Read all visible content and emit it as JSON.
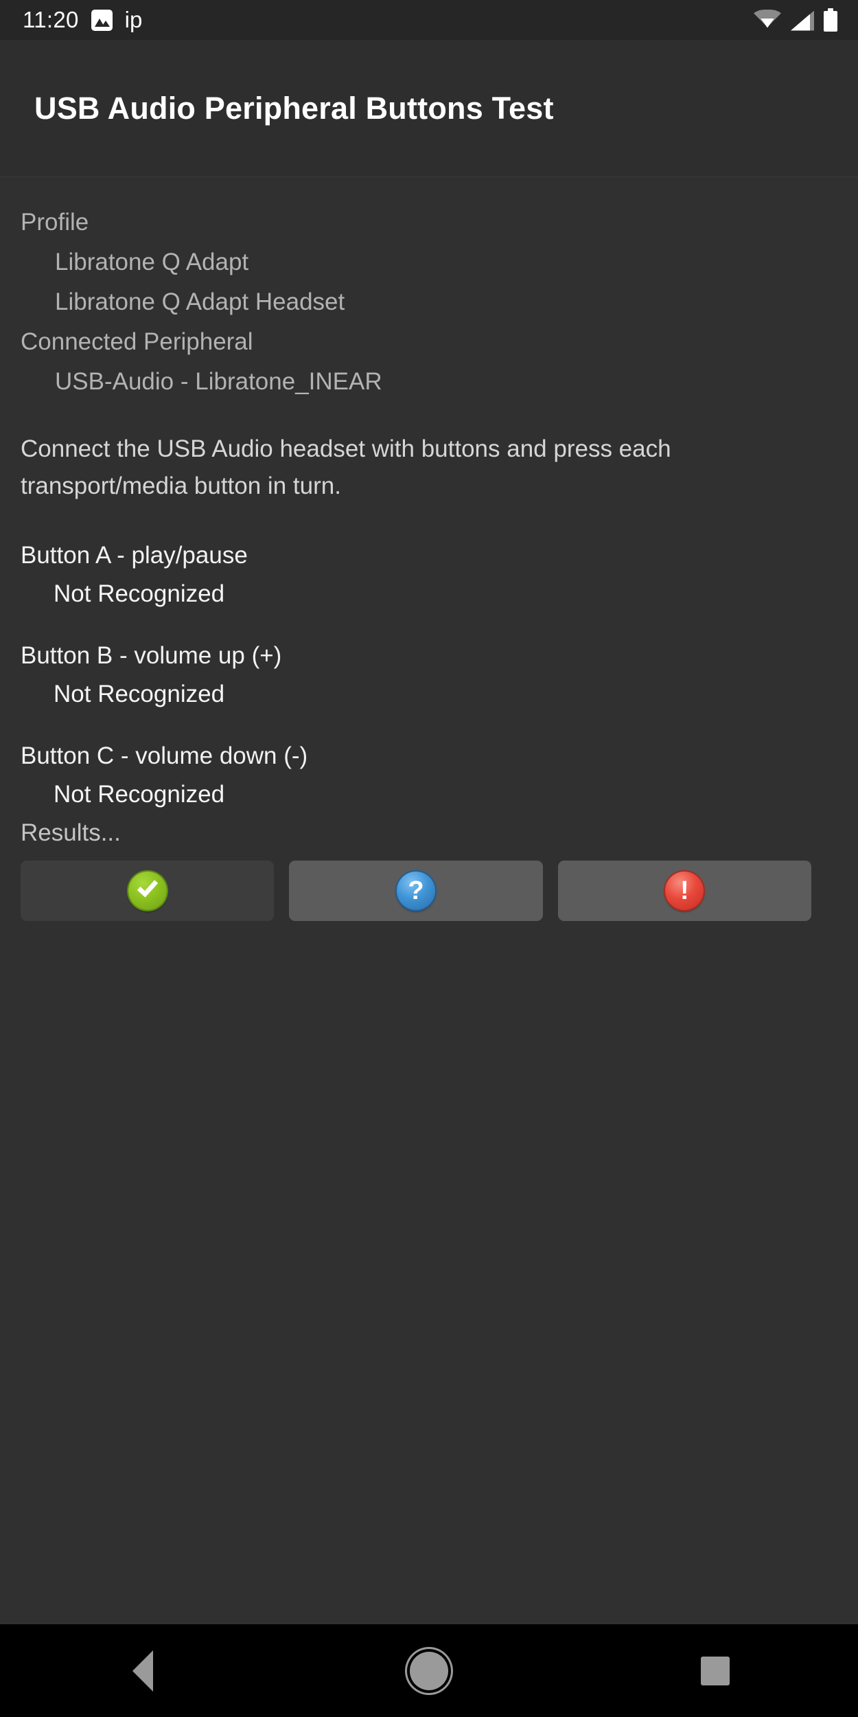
{
  "statusbar": {
    "time": "11:20",
    "notification_label": "ip",
    "icons": [
      "photo-icon",
      "wifi-icon",
      "signal-icon",
      "battery-icon"
    ]
  },
  "appbar": {
    "title": "USB Audio Peripheral Buttons Test"
  },
  "info": {
    "profile_label": "Profile",
    "profile_values": [
      "Libratone Q Adapt",
      "Libratone Q Adapt Headset"
    ],
    "connected_label": "Connected Peripheral",
    "connected_value": "USB-Audio - Libratone_INEAR"
  },
  "instructions": "Connect the USB Audio headset with buttons and press each transport/media button in turn.",
  "buttons": [
    {
      "title": "Button A - play/pause",
      "status": "Not Recognized"
    },
    {
      "title": "Button B - volume up (+)",
      "status": "Not Recognized"
    },
    {
      "title": "Button C - volume down (-)",
      "status": "Not Recognized"
    }
  ],
  "results": {
    "label": "Results...",
    "actions": [
      {
        "name": "pass",
        "icon": "check-circle-icon",
        "glyph": "",
        "enabled": false,
        "color": "#8cc21f"
      },
      {
        "name": "info",
        "icon": "question-circle-icon",
        "glyph": "?",
        "enabled": true,
        "color": "#3f94d6"
      },
      {
        "name": "fail",
        "icon": "exclamation-circle-icon",
        "glyph": "!",
        "enabled": true,
        "color": "#e8483a"
      }
    ]
  },
  "navbar": {
    "back": "back-icon",
    "home": "home-icon",
    "recents": "recents-icon"
  },
  "colors": {
    "background": "#303030",
    "appbar": "#2e2e2e",
    "statusbar": "#262626",
    "navbar": "#000000",
    "text_dim": "#b3b3b3",
    "text_bright": "#f2f2f2"
  }
}
